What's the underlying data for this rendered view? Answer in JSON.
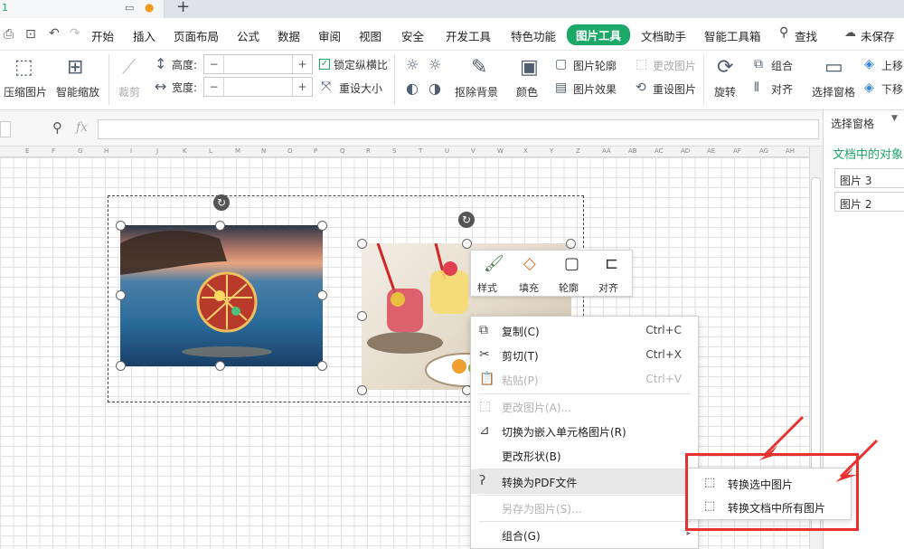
{
  "tabbar": {
    "tab_fragment": "1"
  },
  "menu": {
    "items": [
      "开始",
      "插入",
      "页面布局",
      "公式",
      "数据",
      "审阅",
      "视图",
      "安全",
      "开发工具",
      "特色功能",
      "图片工具",
      "文档助手",
      "智能工具箱"
    ],
    "active": "图片工具",
    "search": "查找",
    "unsaved": "未保存",
    "accent": "#1ca867"
  },
  "ribbon": {
    "compress": "压缩图片",
    "smart_zoom": "智能缩放",
    "crop": "裁剪",
    "height_label": "高度:",
    "width_label": "宽度:",
    "height_value": "",
    "width_value": "",
    "lock_ratio": "锁定纵横比",
    "reset_size": "重设大小",
    "remove_bg": "抠除背景",
    "color": "颜色",
    "outline": "图片轮廓",
    "effects": "图片效果",
    "change_pic": "更改图片",
    "reset_pic": "重设图片",
    "rotate": "旋转",
    "group": "组合",
    "align": "对齐",
    "selection_pane": "选择窗格",
    "move_up": "上移",
    "move_down": "下移"
  },
  "formula_bar": {
    "fx": "fx",
    "value": ""
  },
  "columns": [
    "E",
    "F",
    "G",
    "H",
    "I",
    "J",
    "K",
    "L",
    "M",
    "N",
    "O",
    "P",
    "Q",
    "R",
    "S",
    "T",
    "U",
    "V",
    "W",
    "X",
    "Y",
    "Z",
    "AA",
    "AB",
    "AC",
    "AD",
    "AE",
    "AF",
    "AG",
    "AH"
  ],
  "right_pane": {
    "title": "选择窗格",
    "subtitle": "文档中的对象",
    "objects": [
      "图片 3",
      "图片 2"
    ]
  },
  "mini_toolbar": {
    "items": [
      "样式",
      "填充",
      "轮廓",
      "对齐"
    ]
  },
  "context_menu": {
    "items": [
      {
        "label": "复制(C)",
        "shortcut": "Ctrl+C",
        "icon": "copy-icon",
        "disabled": false
      },
      {
        "label": "剪切(T)",
        "shortcut": "Ctrl+X",
        "icon": "scissors-icon",
        "disabled": false
      },
      {
        "label": "粘贴(P)",
        "shortcut": "Ctrl+V",
        "icon": "paste-icon",
        "disabled": true
      },
      {
        "label": "更改图片(A)...",
        "shortcut": "",
        "icon": "change-picture-icon",
        "disabled": true
      },
      {
        "label": "切换为嵌入单元格图片(R)",
        "shortcut": "",
        "icon": "embed-cell-icon",
        "disabled": false
      },
      {
        "label": "更改形状(B)",
        "shortcut": "",
        "icon": "",
        "disabled": false
      },
      {
        "label": "转换为PDF文件",
        "shortcut": "",
        "icon": "pdf-icon",
        "disabled": false,
        "highlighted": true
      },
      {
        "label": "另存为图片(S)...",
        "shortcut": "",
        "icon": "",
        "disabled": true
      },
      {
        "label": "组合(G)",
        "shortcut": "",
        "icon": "",
        "disabled": false
      }
    ]
  },
  "submenu": {
    "items": [
      "转换选中图片",
      "转换文档中所有图片"
    ]
  },
  "colors": {
    "annotation_red": "#e8302f",
    "sheet_grid": "#e2e2e2"
  }
}
